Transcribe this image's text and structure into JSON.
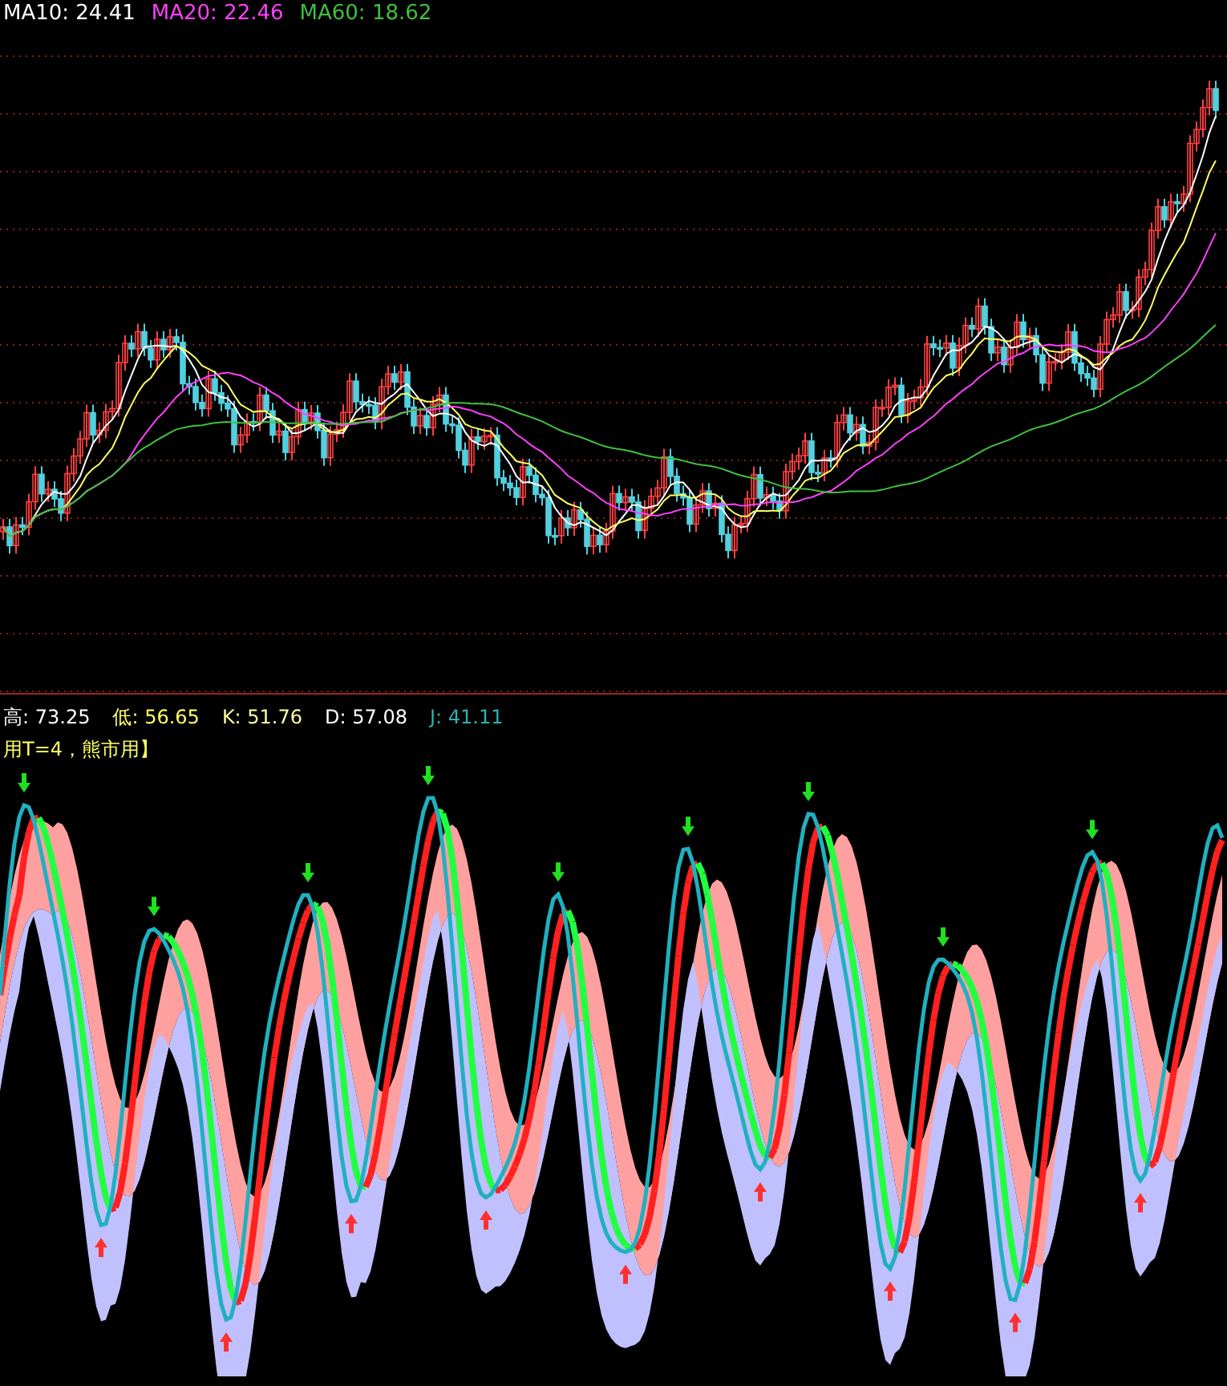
{
  "main_chart": {
    "legend": [
      {
        "text": "MA10: 24.41",
        "color": "#ffffff"
      },
      {
        "text": "MA20: 22.46",
        "color": "#ff40ff"
      },
      {
        "text": "MA60: 18.62",
        "color": "#40c040"
      }
    ]
  },
  "indicator": {
    "readings": [
      {
        "text": "高: 73.25",
        "color": "#ffffff"
      },
      {
        "text": "低: 56.65",
        "color": "#ffff60"
      },
      {
        "text": "K: 51.76",
        "color": "#ffffa0"
      },
      {
        "text": "D: 57.08",
        "color": "#ffffff"
      },
      {
        "text": "J: 41.11",
        "color": "#2fb0b0"
      }
    ],
    "note": "用T=4，熊市用】"
  }
}
